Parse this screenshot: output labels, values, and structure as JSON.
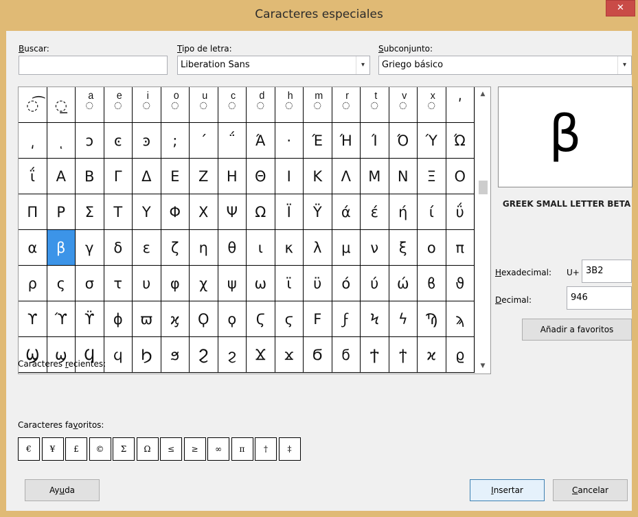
{
  "window": {
    "title": "Caracteres especiales",
    "close_glyph": "✕"
  },
  "search": {
    "label_prefix": "",
    "label_ul": "B",
    "label_rest": "uscar:",
    "value": ""
  },
  "font": {
    "label_ul": "T",
    "label_rest": "ipo de letra:",
    "value": "Liberation Sans"
  },
  "subset": {
    "label_ul": "S",
    "label_rest": "ubconjunto:",
    "value": "Griego básico"
  },
  "grid": {
    "rows": [
      [
        "◌͡",
        "◌̲",
        "◌ͣ",
        "◌ͤ",
        "◌ͥ",
        "◌ͦ",
        "◌ͧ",
        "◌ͨ",
        "◌ͩ",
        "◌ͪ",
        "◌ͫ",
        "◌ͬ",
        "◌ͭ",
        "◌ͮ",
        "◌ͯ",
        "ʹ"
      ],
      [
        "͵",
        "ͺ",
        "ͻ",
        "ͼ",
        "ͽ",
        ";",
        "΄",
        "΅",
        "Ά",
        "·",
        "Έ",
        "Ή",
        "Ί",
        "Ό",
        "Ύ",
        "Ώ"
      ],
      [
        "ΐ",
        "Α",
        "Β",
        "Γ",
        "Δ",
        "Ε",
        "Ζ",
        "Η",
        "Θ",
        "Ι",
        "Κ",
        "Λ",
        "Μ",
        "Ν",
        "Ξ",
        "Ο"
      ],
      [
        "Π",
        "Ρ",
        "Σ",
        "Τ",
        "Υ",
        "Φ",
        "Χ",
        "Ψ",
        "Ω",
        "Ϊ",
        "Ϋ",
        "ά",
        "έ",
        "ή",
        "ί",
        "ΰ"
      ],
      [
        "α",
        "β",
        "γ",
        "δ",
        "ε",
        "ζ",
        "η",
        "θ",
        "ι",
        "κ",
        "λ",
        "μ",
        "ν",
        "ξ",
        "ο",
        "π"
      ],
      [
        "ρ",
        "ς",
        "σ",
        "τ",
        "υ",
        "φ",
        "χ",
        "ψ",
        "ω",
        "ϊ",
        "ϋ",
        "ό",
        "ύ",
        "ώ",
        "ϐ",
        "ϑ"
      ],
      [
        "ϒ",
        "ϓ",
        "ϔ",
        "ϕ",
        "ϖ",
        "ϗ",
        "Ϙ",
        "ϙ",
        "Ϛ",
        "ϛ",
        "Ϝ",
        "ϝ",
        "Ϟ",
        "ϟ",
        "Ϡ",
        "ϡ"
      ],
      [
        "Ϣ",
        "ϣ",
        "Ϥ",
        "ϥ",
        "Ϧ",
        "ϧ",
        "Ϩ",
        "ϩ",
        "Ϫ",
        "ϫ",
        "Ϭ",
        "ϭ",
        "Ϯ",
        "ϯ",
        "ϰ",
        "ϱ"
      ]
    ],
    "selected": [
      4,
      1
    ]
  },
  "preview": {
    "char": "β",
    "name": "GREEK SMALL LETTER BETA"
  },
  "hex": {
    "label_ul": "H",
    "label_rest": "exadecimal:",
    "prefix": "U+",
    "value": "3B2"
  },
  "dec": {
    "label_ul": "D",
    "label_rest": "ecimal:",
    "value": "946"
  },
  "add_fav_button": "Añadir a favoritos",
  "recent": {
    "label_a": "Caracteres ",
    "label_ul": "r",
    "label_b": "ecientes:"
  },
  "favorites": {
    "label_a": "Caracteres fa",
    "label_ul": "v",
    "label_b": "oritos:",
    "items": [
      "€",
      "¥",
      "£",
      "©",
      "Σ",
      "Ω",
      "≤",
      "≥",
      "∞",
      "π",
      "†",
      "‡"
    ]
  },
  "buttons": {
    "help_a": "Ay",
    "help_ul": "u",
    "help_b": "da",
    "insert_ul": "I",
    "insert_b": "nsertar",
    "cancel_ul": "C",
    "cancel_b": "ancelar"
  },
  "colors": {
    "title_bar": "#e0ba75",
    "close": "#c94b47",
    "selection": "#3c94e8"
  }
}
